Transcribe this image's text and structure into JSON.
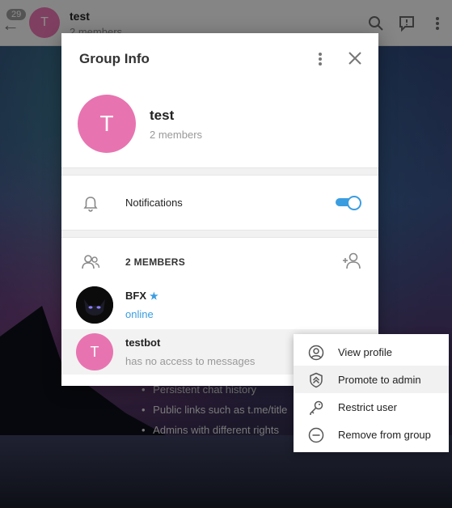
{
  "header": {
    "badge": "29",
    "avatar_letter": "T",
    "title": "test",
    "subtitle": "2 members"
  },
  "background_bullets": [
    "Persistent chat history",
    "Public links such as t.me/title",
    "Admins with different rights"
  ],
  "dialog": {
    "title": "Group Info",
    "group": {
      "avatar_letter": "T",
      "name": "test",
      "member_count": "2 members"
    },
    "notifications": {
      "label": "Notifications",
      "enabled": true
    },
    "members": {
      "heading": "2 MEMBERS",
      "list": [
        {
          "name": "BFX",
          "status": "online",
          "status_color": "#3a9de0",
          "is_owner": true
        },
        {
          "name": "testbot",
          "avatar_letter": "T",
          "status": "has no access to messages",
          "status_color": "#999999"
        }
      ]
    }
  },
  "context_menu": {
    "items": [
      {
        "label": "View profile",
        "icon": "user-circle-icon"
      },
      {
        "label": "Promote to admin",
        "icon": "shield-up-icon"
      },
      {
        "label": "Restrict user",
        "icon": "key-icon"
      },
      {
        "label": "Remove from group",
        "icon": "minus-circle-icon"
      }
    ]
  },
  "colors": {
    "accent": "#3a9de0",
    "avatar_pink": "#e774b0"
  }
}
